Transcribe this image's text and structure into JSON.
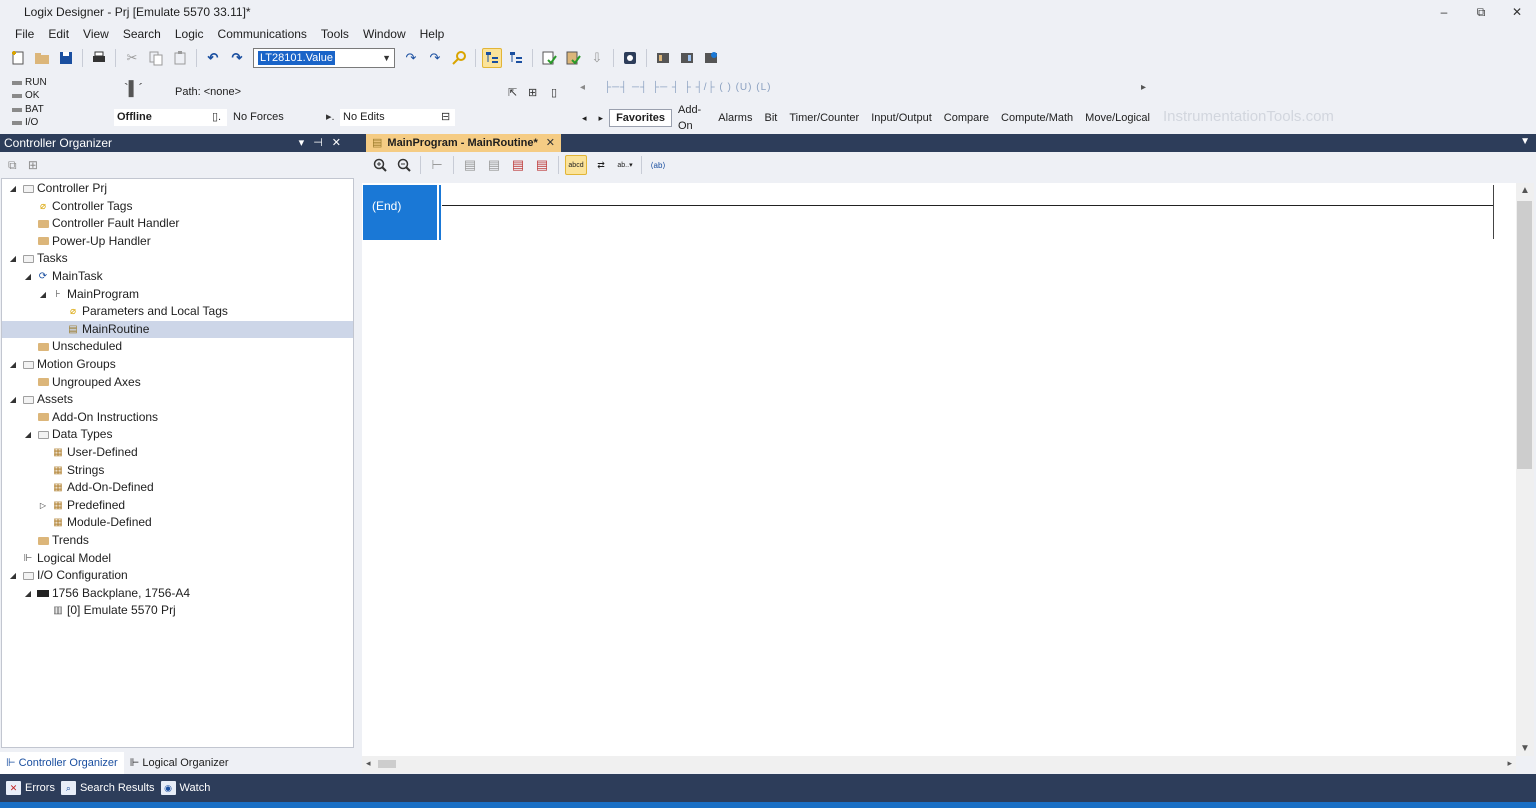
{
  "window": {
    "title": "Logix Designer - Prj [Emulate 5570 33.11]*",
    "minimize": "‒",
    "restore": "⧉",
    "close": "✕"
  },
  "menu": [
    "File",
    "Edit",
    "View",
    "Search",
    "Logic",
    "Communications",
    "Tools",
    "Window",
    "Help"
  ],
  "toolbar": {
    "tag_combo_value": "LT28101.Value"
  },
  "status": {
    "leds": [
      "RUN",
      "OK",
      "BAT",
      "I/O"
    ],
    "path_label": "Path: <none>",
    "mode": "Offline",
    "forces": "No Forces",
    "edits": "No Edits"
  },
  "instruction_tabs": [
    "Favorites",
    "Add-On",
    "Alarms",
    "Bit",
    "Timer/Counter",
    "Input/Output",
    "Compare",
    "Compute/Math",
    "Move/Logical"
  ],
  "instruction_glyphs": "├─┤  ─┤ ├─  ┤ ├  ┤/├  ( )  (U)  (L)",
  "watermark": "InstrumentationTools.com",
  "controller_organizer": {
    "title": "Controller Organizer",
    "tree": [
      {
        "label": "Controller Prj",
        "level": 0,
        "expander": "◢",
        "icon": "folder-open"
      },
      {
        "label": "Controller Tags",
        "level": 1,
        "expander": "",
        "icon": "tag"
      },
      {
        "label": "Controller Fault Handler",
        "level": 1,
        "expander": "",
        "icon": "folder"
      },
      {
        "label": "Power-Up Handler",
        "level": 1,
        "expander": "",
        "icon": "folder"
      },
      {
        "label": "Tasks",
        "level": 0,
        "expander": "◢",
        "icon": "folder-open"
      },
      {
        "label": "MainTask",
        "level": 1,
        "expander": "◢",
        "icon": "task"
      },
      {
        "label": "MainProgram",
        "level": 2,
        "expander": "◢",
        "icon": "program"
      },
      {
        "label": "Parameters and Local Tags",
        "level": 3,
        "expander": "",
        "icon": "tag"
      },
      {
        "label": "MainRoutine",
        "level": 3,
        "expander": "",
        "icon": "routine",
        "selected": true
      },
      {
        "label": "Unscheduled",
        "level": 1,
        "expander": "",
        "icon": "folder"
      },
      {
        "label": "Motion Groups",
        "level": 0,
        "expander": "◢",
        "icon": "folder-open"
      },
      {
        "label": "Ungrouped Axes",
        "level": 1,
        "expander": "",
        "icon": "folder"
      },
      {
        "label": "Assets",
        "level": 0,
        "expander": "◢",
        "icon": "folder-open"
      },
      {
        "label": "Add-On Instructions",
        "level": 1,
        "expander": "",
        "icon": "folder"
      },
      {
        "label": "Data Types",
        "level": 1,
        "expander": "◢",
        "icon": "folder-open"
      },
      {
        "label": "User-Defined",
        "level": 2,
        "expander": "",
        "icon": "datatype"
      },
      {
        "label": "Strings",
        "level": 2,
        "expander": "",
        "icon": "datatype"
      },
      {
        "label": "Add-On-Defined",
        "level": 2,
        "expander": "",
        "icon": "datatype"
      },
      {
        "label": "Predefined",
        "level": 2,
        "expander": "▷",
        "icon": "datatype"
      },
      {
        "label": "Module-Defined",
        "level": 2,
        "expander": "",
        "icon": "datatype"
      },
      {
        "label": "Trends",
        "level": 1,
        "expander": "",
        "icon": "folder"
      },
      {
        "label": "Logical Model",
        "level": 0,
        "expander": "",
        "icon": "model"
      },
      {
        "label": "I/O Configuration",
        "level": 0,
        "expander": "◢",
        "icon": "folder-open"
      },
      {
        "label": "1756 Backplane, 1756-A4",
        "level": 1,
        "expander": "◢",
        "icon": "backplane"
      },
      {
        "label": "[0] Emulate 5570 Prj",
        "level": 2,
        "expander": "",
        "icon": "module"
      }
    ],
    "bottom_tabs": [
      "Controller Organizer",
      "Logical Organizer"
    ]
  },
  "editor": {
    "tab_label": "MainProgram - MainRoutine*",
    "end_label": "(End)"
  },
  "bottom_panels": [
    "Errors",
    "Search Results",
    "Watch"
  ]
}
